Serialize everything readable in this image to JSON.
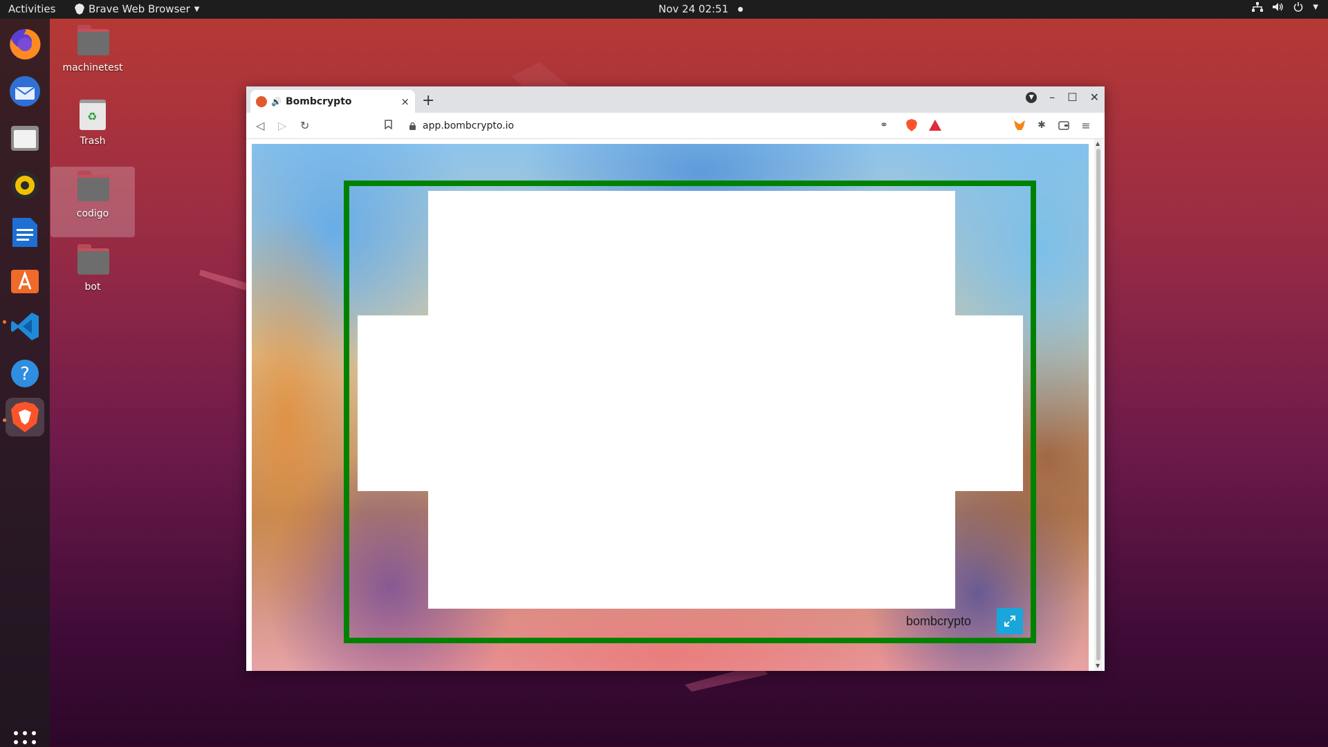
{
  "topbar": {
    "activities": "Activities",
    "app_name": "Brave Web Browser",
    "datetime": "Nov 24  02:51"
  },
  "desktop": {
    "icons": [
      {
        "label": "machinetest"
      },
      {
        "label": "Trash"
      },
      {
        "label": "codigo"
      },
      {
        "label": "bot"
      }
    ]
  },
  "browser": {
    "tab_title": "Bombcrypto",
    "url": "app.bombcrypto.io",
    "new_tab": "+",
    "close_tab": "×"
  },
  "game": {
    "brand": "bombcrypto",
    "frame_color": "#008000",
    "fullscreen_icon": "expand-arrows-icon"
  }
}
